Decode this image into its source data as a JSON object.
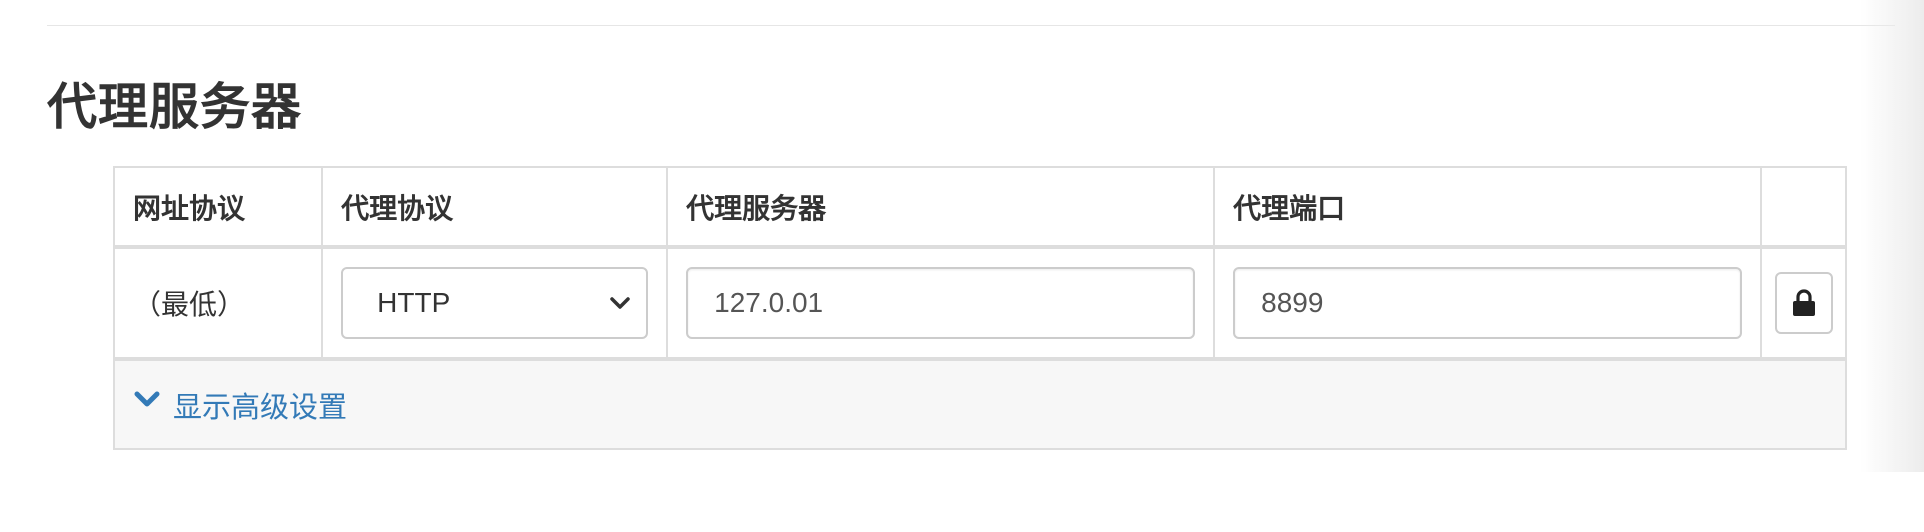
{
  "section": {
    "title": "代理服务器"
  },
  "table": {
    "headers": {
      "url_protocol": "网址协议",
      "proxy_protocol": "代理协议",
      "proxy_server": "代理服务器",
      "proxy_port": "代理端口"
    },
    "row": {
      "url_scope": "（最低）",
      "proxy_protocol_value": "HTTP",
      "proxy_server_value": "127.0.01",
      "proxy_port_value": "8899",
      "lock_icon": "lock-icon"
    }
  },
  "advanced": {
    "label": "显示高级设置",
    "icon": "chevron-down-icon"
  },
  "colors": {
    "link": "#337ab7",
    "border": "#dddddd",
    "advanced_bg": "#f7f7f7"
  }
}
